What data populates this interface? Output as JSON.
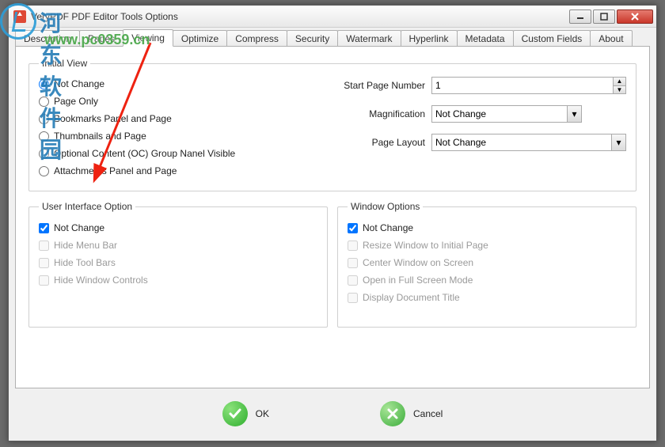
{
  "window": {
    "title": "VeryPDF PDF Editor Tools Options"
  },
  "tabs": [
    "Description",
    "Pages",
    "Viewing",
    "Optimize",
    "Compress",
    "Security",
    "Watermark",
    "Hyperlink",
    "Metadata",
    "Custom Fields",
    "About"
  ],
  "active_tab_index": 2,
  "initial_view": {
    "legend": "Initial View",
    "options": [
      "Not Change",
      "Page Only",
      "Bookmarks Panel and Page",
      "Thumbnails and Page",
      "Optional Content (OC) Group Nanel Visible",
      "Attachments Panel and Page"
    ],
    "selected_index": 0,
    "start_page_label": "Start Page Number",
    "start_page_value": "1",
    "magnification_label": "Magnification",
    "magnification_value": "Not Change",
    "page_layout_label": "Page Layout",
    "page_layout_value": "Not Change"
  },
  "ui_option": {
    "legend": "User Interface Option",
    "items": [
      {
        "label": "Not Change",
        "checked": true,
        "enabled": true
      },
      {
        "label": "Hide Menu Bar",
        "checked": false,
        "enabled": false
      },
      {
        "label": "Hide Tool Bars",
        "checked": false,
        "enabled": false
      },
      {
        "label": "Hide Window Controls",
        "checked": false,
        "enabled": false
      }
    ]
  },
  "win_option": {
    "legend": "Window Options",
    "items": [
      {
        "label": "Not Change",
        "checked": true,
        "enabled": true
      },
      {
        "label": "Resize Window to Initial Page",
        "checked": false,
        "enabled": false
      },
      {
        "label": "Center Window on Screen",
        "checked": false,
        "enabled": false
      },
      {
        "label": "Open in Full Screen Mode",
        "checked": false,
        "enabled": false
      },
      {
        "label": "Display Document Title",
        "checked": false,
        "enabled": false
      }
    ]
  },
  "buttons": {
    "ok": "OK",
    "cancel": "Cancel"
  },
  "watermark": {
    "cn": "河东软件园",
    "url": "www.pc0359.cn"
  }
}
